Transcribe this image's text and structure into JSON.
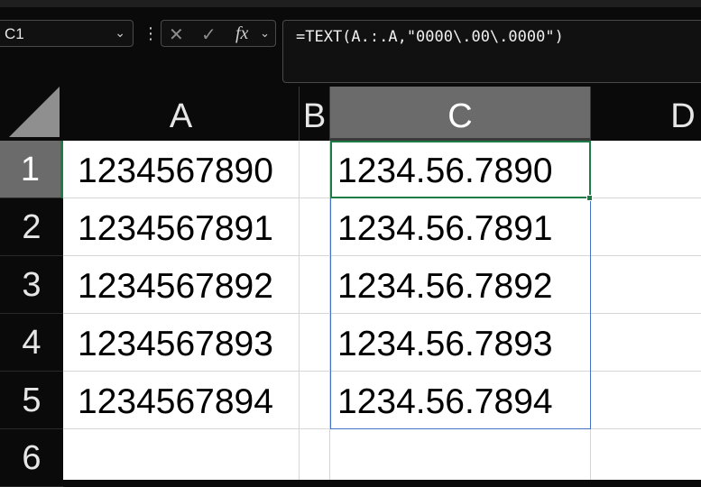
{
  "namebox": {
    "value": "C1"
  },
  "formula_bar": {
    "formula": "=TEXT(A.:.A,\"0000\\.00\\.0000\")",
    "icons": [
      "close-icon",
      "check-icon",
      "fx-icon"
    ]
  },
  "columns": [
    "A",
    "B",
    "C",
    "D"
  ],
  "rows": [
    "1",
    "2",
    "3",
    "4",
    "5",
    "6"
  ],
  "column_a": [
    "1234567890",
    "1234567891",
    "1234567892",
    "1234567893",
    "1234567894",
    ""
  ],
  "column_c": [
    "1234.56.7890",
    "1234.56.7891",
    "1234.56.7892",
    "1234.56.7893",
    "1234.56.7894",
    ""
  ],
  "colors": {
    "active_cell_border": "#1e7a47",
    "selection_border": "#4472c4",
    "header_selected": "#6b6b6b"
  }
}
